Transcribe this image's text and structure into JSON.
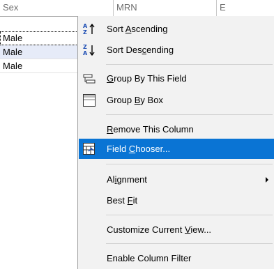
{
  "grid": {
    "columns": [
      "Sex",
      "MRN",
      "E"
    ],
    "rows": [
      {
        "sex": "Male"
      },
      {
        "sex": "Male"
      },
      {
        "sex": "Male"
      }
    ]
  },
  "menu": {
    "items": [
      {
        "pre": "Sort ",
        "key": "A",
        "post": "scending",
        "icon": "sort-ascending-icon"
      },
      {
        "pre": "Sort Des",
        "key": "c",
        "post": "ending",
        "icon": "sort-descending-icon"
      },
      {
        "pre": "",
        "key": "G",
        "post": "roup By This Field",
        "icon": "group-by-field-icon"
      },
      {
        "pre": "Group ",
        "key": "B",
        "post": "y Box",
        "icon": "group-by-box-icon"
      },
      {
        "pre": "",
        "key": "R",
        "post": "emove This Column",
        "icon": ""
      },
      {
        "pre": "Field ",
        "key": "C",
        "post": "hooser...",
        "icon": "field-chooser-icon"
      },
      {
        "pre": "Al",
        "key": "i",
        "post": "gnment",
        "icon": ""
      },
      {
        "pre": "Best ",
        "key": "F",
        "post": "it",
        "icon": ""
      },
      {
        "pre": "Customize Current ",
        "key": "V",
        "post": "iew...",
        "icon": ""
      },
      {
        "pre": "Enable Column Filter",
        "key": "",
        "post": "",
        "icon": ""
      }
    ],
    "highlight_color": "#0a74d4",
    "background_color": "#f2f2f2"
  }
}
